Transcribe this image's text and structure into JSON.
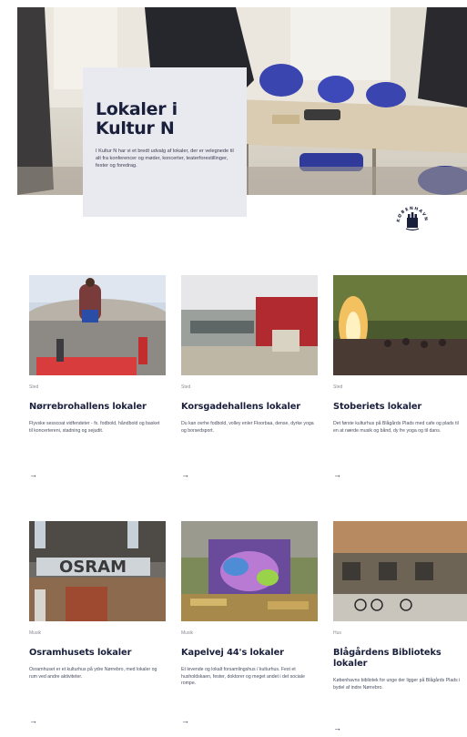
{
  "hero": {
    "title": "Lokaler i Kultur N",
    "text": "I Kultur N har vi et bredt udvalg af lokaler, der er velegnede til alt fra konferencer og møder, koncerter, teaterforestillinger, fester og foredrag."
  },
  "logo": {
    "icon": "koebenhavn-seal-icon",
    "ring_text": "KØBENHAVN"
  },
  "cards": [
    {
      "tag": "Sted",
      "title": "Nørrebrohallens lokaler",
      "desc": "Flyvske sesscoat vidfendeter - fx. fodbold, håndbold og basket til koncertereni, stadning og sejudit.",
      "arrow": "→"
    },
    {
      "tag": "Sted",
      "title": "Korsgadehallens lokaler",
      "desc": "Du kan ovrhe fodbold, volley enler Floorbaa, dense, dyrke yoga og borsedsport.",
      "arrow": "→"
    },
    {
      "tag": "Sted",
      "title": "Stoberiets lokaler",
      "desc": "Det første kulturhus på Blågårds Plads med cafe og plads til en at nærde musik og bånd, dy fre yoga og til dans.",
      "arrow": "→"
    },
    {
      "tag": "Musik",
      "title": "Osramhusets lokaler",
      "desc": "Osramhuset er et kulturhus på ydre Nørrebro, med lokaler og rum ved andre aktiviteter.",
      "arrow": "→"
    },
    {
      "tag": "Musik",
      "title": "Kapelvej 44's lokaler",
      "desc": "Et levende og lokalt forsamlingshus / kulturhus. Fest et husholdskaen, fester, doktorer og meget andet i det sociale rompe.",
      "arrow": "→"
    },
    {
      "tag": "Hus",
      "title": "Blågårdens Biblioteks lokaler",
      "desc": "Københavns bibliotek for unge der ligger på Blågårds Plads i bydel af indre Nørrebro.",
      "arrow": "→"
    }
  ],
  "colors": {
    "navy": "#1a1f3c",
    "panel": "#e8eaef",
    "chair_blue": "#3a45b0"
  }
}
